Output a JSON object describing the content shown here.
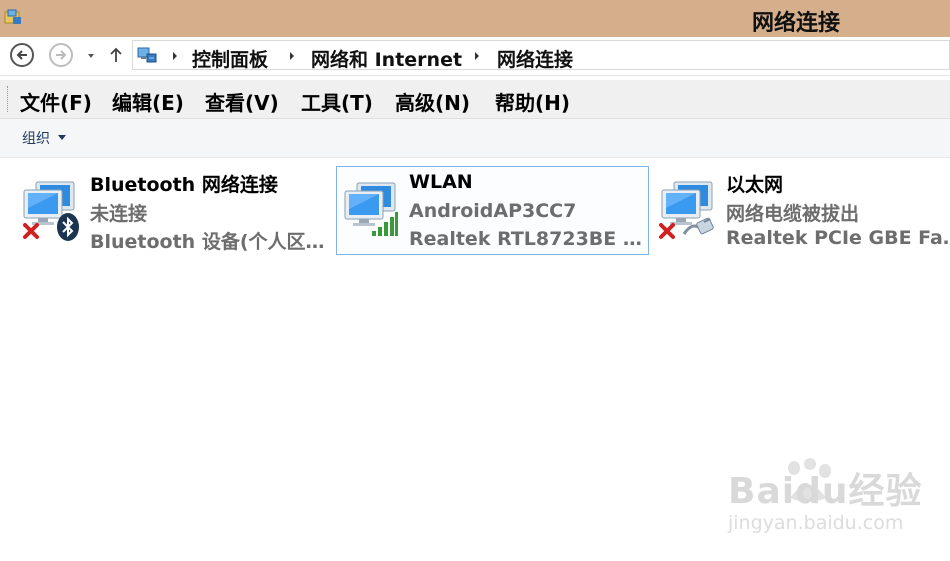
{
  "window": {
    "title": "网络连接"
  },
  "address": {
    "crumbs": [
      "控制面板",
      "网络和 Internet",
      "网络连接"
    ]
  },
  "menu": {
    "items": [
      "文件(F)",
      "编辑(E)",
      "查看(V)",
      "工具(T)",
      "高级(N)",
      "帮助(H)"
    ]
  },
  "toolbar": {
    "organize_label": "组织"
  },
  "connections": [
    {
      "name": "Bluetooth 网络连接",
      "status": "未连接",
      "device": "Bluetooth 设备(个人区…",
      "overlay": "bluetooth-icon",
      "badge": "red-x-icon",
      "selected": false
    },
    {
      "name": "WLAN",
      "status": "AndroidAP3CC7",
      "device": "Realtek RTL8723BE …",
      "overlay": "signal-bars-icon",
      "badge": "",
      "selected": true
    },
    {
      "name": "以太网",
      "status": "网络电缆被拔出",
      "device": "Realtek PCIe GBE Fa…",
      "overlay": "ethernet-cable-icon",
      "badge": "red-x-icon",
      "selected": false
    }
  ],
  "watermark": {
    "main": "Baidu经验",
    "sub": "jingyan.baidu.com"
  },
  "colors": {
    "titlebar": "#d5ae8c",
    "selection_border": "#7eb4ea",
    "signal": "#3a9a3a",
    "error_x": "#d02020"
  }
}
